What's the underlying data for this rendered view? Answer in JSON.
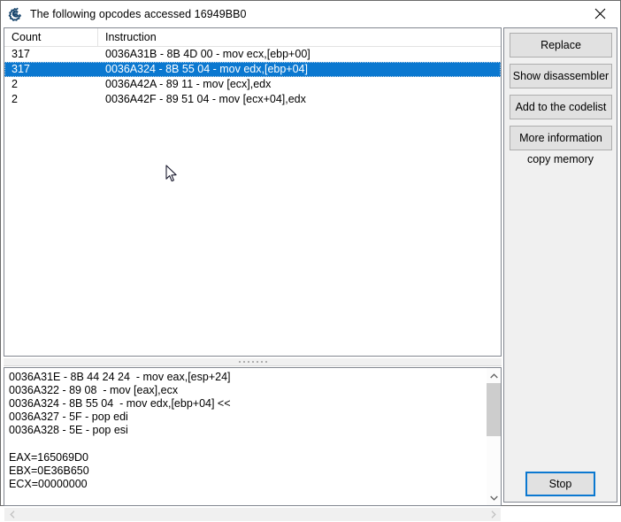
{
  "window": {
    "title": "The following opcodes accessed 16949BB0",
    "icon": "cheat-engine-icon",
    "close_label": "✕",
    "accent_color": "#0b78d0",
    "frame_color": "#6b6b6b",
    "panel_color": "#f0f0f0"
  },
  "list": {
    "columns": [
      "Count",
      "Instruction"
    ],
    "rows": [
      {
        "count": "317",
        "instruction": "0036A31B - 8B 4D 00  - mov ecx,[ebp+00]",
        "selected": false
      },
      {
        "count": "317",
        "instruction": "0036A324 - 8B 55 04  - mov edx,[ebp+04]",
        "selected": true
      },
      {
        "count": "2",
        "instruction": "0036A42A - 89 11  - mov [ecx],edx",
        "selected": false
      },
      {
        "count": "2",
        "instruction": "0036A42F - 89 51 04  - mov [ecx+04],edx",
        "selected": false
      }
    ]
  },
  "memory_view": {
    "lines": [
      "0036A31E - 8B 44 24 24  - mov eax,[esp+24]",
      "0036A322 - 89 08  - mov [eax],ecx",
      "0036A324 - 8B 55 04  - mov edx,[ebp+04] << ",
      "0036A327 - 5F - pop edi",
      "0036A328 - 5E - pop esi",
      "",
      "EAX=165069D0",
      "EBX=0E36B650",
      "ECX=00000000"
    ],
    "vscroll_up_icon": "chevron-up-icon",
    "vscroll_down_icon": "chevron-down-icon",
    "hscroll_left_icon": "chevron-left-icon",
    "hscroll_right_icon": "chevron-right-icon"
  },
  "buttons": {
    "replace": "Replace",
    "show_disassembler": "Show disassembler",
    "add_to_codelist": "Add to the codelist",
    "more_information": "More information",
    "copy_memory": "copy memory",
    "stop": "Stop"
  }
}
